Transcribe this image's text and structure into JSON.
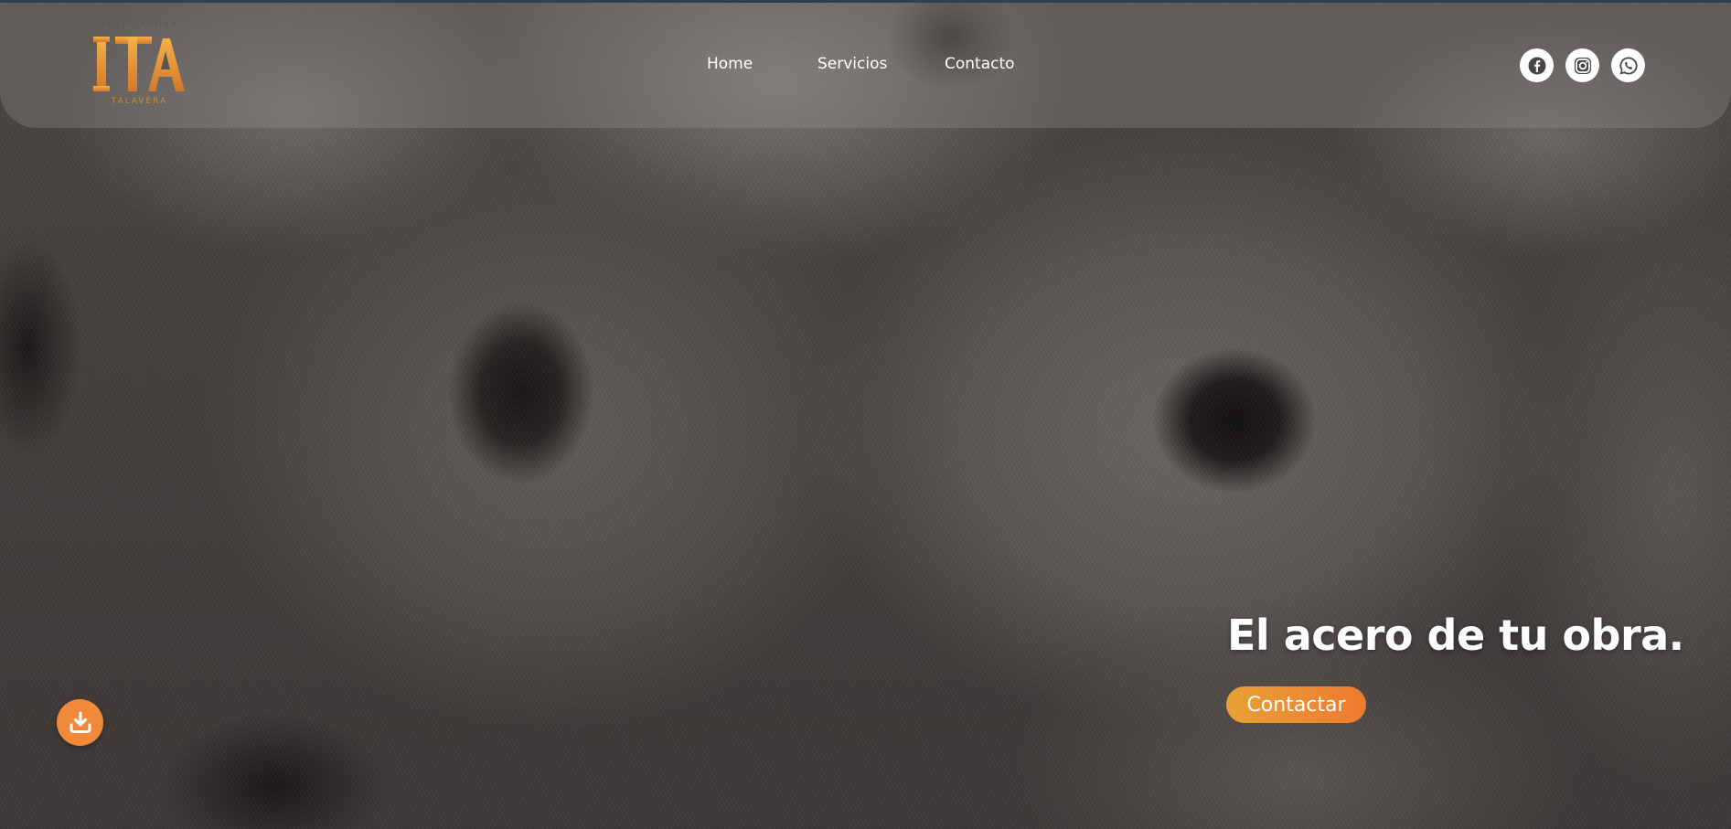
{
  "brand": {
    "logo_letters": "ITA",
    "logo_top_text": "TREFILADORA",
    "logo_bottom_text": "TALAVERA",
    "accent_color": "#ee8a35"
  },
  "nav": {
    "items": [
      {
        "label": "Home"
      },
      {
        "label": "Servicios"
      },
      {
        "label": "Contacto"
      }
    ]
  },
  "social": [
    {
      "icon": "facebook-icon"
    },
    {
      "icon": "instagram-icon"
    },
    {
      "icon": "whatsapp-icon"
    }
  ],
  "hero": {
    "headline": "El acero de tu obra.",
    "cta_label": "Contactar",
    "background": "steel wire coils photo"
  },
  "floating": {
    "download_icon": "download-icon",
    "download_color": "#f08a3a"
  }
}
